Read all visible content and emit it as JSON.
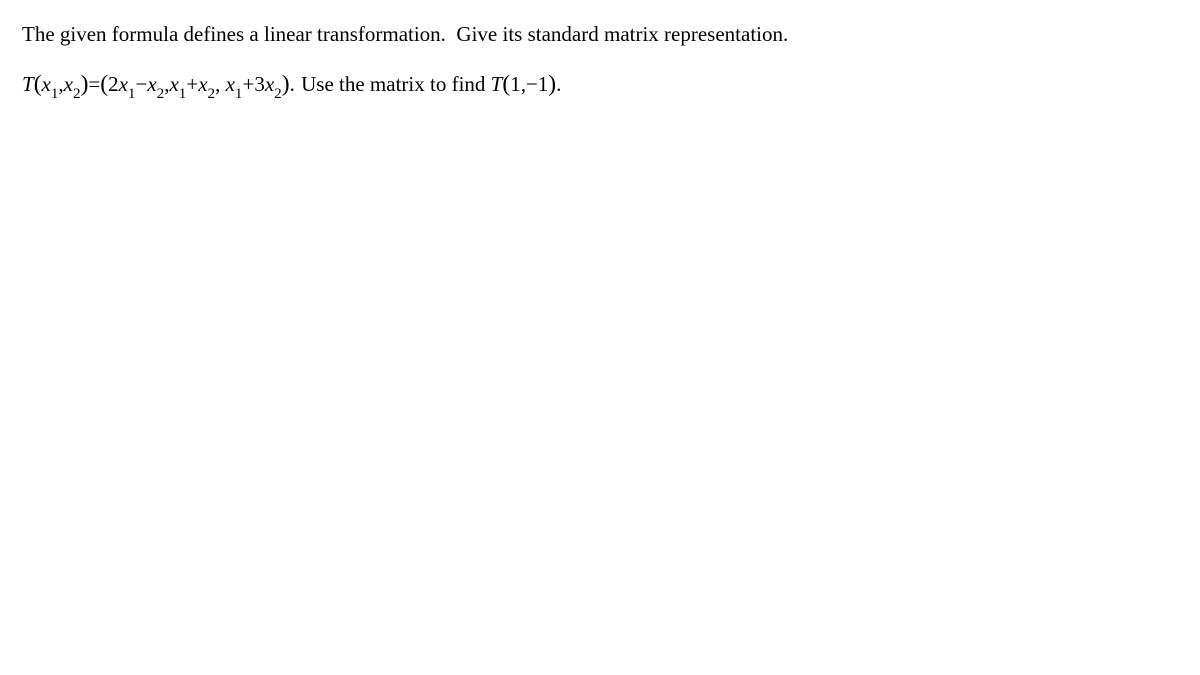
{
  "problem": {
    "line1": "The given formula defines a linear transformation.  Give its standard matrix representation.",
    "formula": {
      "T": "T",
      "lparen1": "(",
      "x1a": "x",
      "sub1a": "1",
      "comma1": ",",
      "x2a": "x",
      "sub2a": "2",
      "rparen1": ")",
      "eq": "=",
      "lparen2": "(",
      "two": "2",
      "x1b": "x",
      "sub1b": "1",
      "minus1": "−",
      "x2b": "x",
      "sub2b": "2",
      "comma2": ",",
      "x1c": "x",
      "sub1c": "1",
      "plus1": "+",
      "x2c": "x",
      "sub2c": "2",
      "comma3": ",",
      "spc": " ",
      "x1d": "x",
      "sub1d": "1",
      "plus2": "+",
      "three": "3",
      "x2d": "x",
      "sub2d": "2",
      "rparen2": ")",
      "period1": "."
    },
    "after_text": "Use the matrix to find",
    "eval": {
      "T": "T",
      "lparen": "(",
      "one": "1",
      "comma": ",",
      "minus": "−",
      "oneB": "1",
      "rparen": ")",
      "period": "."
    }
  }
}
